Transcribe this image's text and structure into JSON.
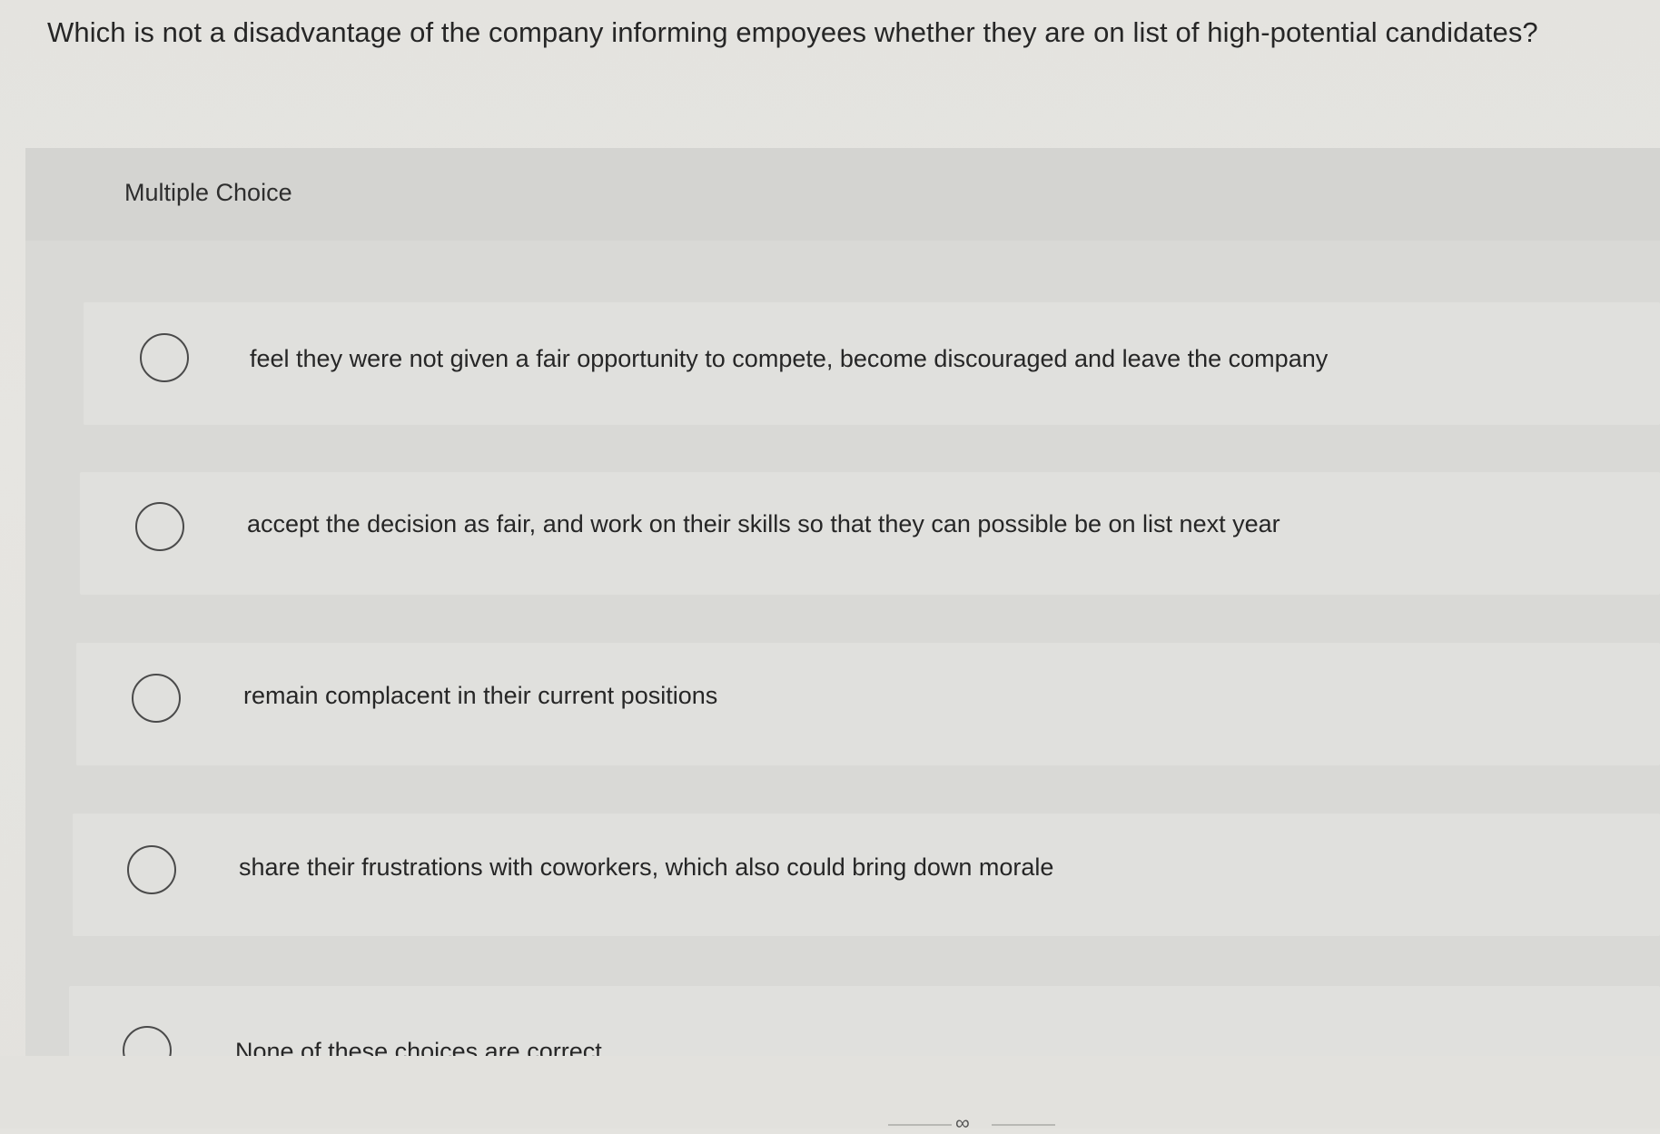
{
  "question": {
    "text": "Which is not a disadvantage of the company informing empoyees whether they are on list of high-potential candidates?"
  },
  "section": {
    "label": "Multiple Choice"
  },
  "options": [
    {
      "label": "feel they were not given a fair opportunity to compete, become discouraged and leave the company"
    },
    {
      "label": "accept the decision as fair, and work on their skills so that they can possible be on list next year"
    },
    {
      "label": "remain complacent in their current positions"
    },
    {
      "label": "share their frustrations with coworkers, which also could bring down morale"
    },
    {
      "label": "None of these choices are correct"
    }
  ],
  "colors": {
    "background": "#e4e3df",
    "panel": "#d9d9d6",
    "option_row": "#e0e0dd",
    "radio_border": "#4a4a4a",
    "text": "#262626"
  }
}
